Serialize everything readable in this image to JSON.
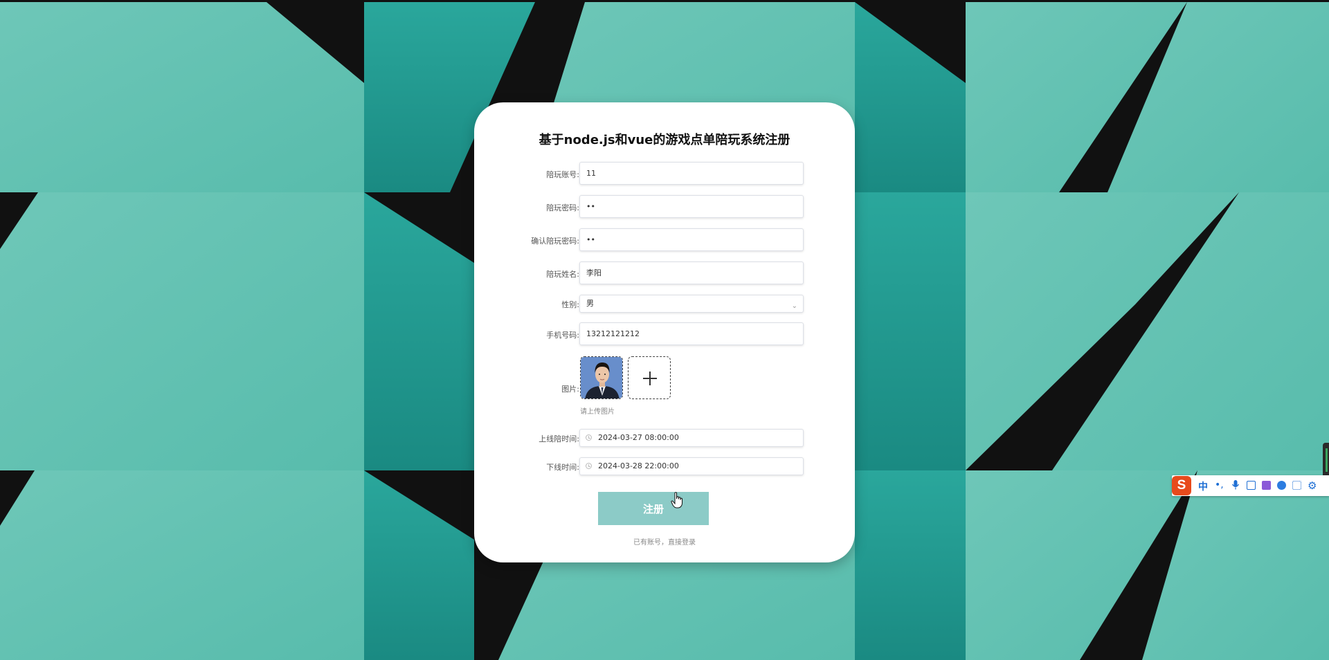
{
  "page": {
    "title": "基于node.js和vue的游戏点单陪玩系统注册"
  },
  "form": {
    "account": {
      "label": "陪玩账号:",
      "value": "11"
    },
    "password": {
      "label": "陪玩密码:",
      "value": "••"
    },
    "confirm_password": {
      "label": "确认陪玩密码:",
      "value": "••"
    },
    "name": {
      "label": "陪玩姓名:",
      "value": "李阳"
    },
    "gender": {
      "label": "性别:",
      "value": "男"
    },
    "phone": {
      "label": "手机号码:",
      "value": "13212121212"
    },
    "photo": {
      "label": "图片:",
      "hint": "请上传图片"
    },
    "online_time": {
      "label": "上线陪时间:",
      "value": "2024-03-27 08:00:00"
    },
    "offline_time": {
      "label": "下线时间:",
      "value": "2024-03-28 22:00:00"
    },
    "submit_label": "注册",
    "login_link": "已有账号，直接登录"
  },
  "ime_toolbar": {
    "logo": "S",
    "mode": "中",
    "punct": "•,"
  },
  "colors": {
    "teal_light": "#66c2b2",
    "teal_dark": "#1e8f88",
    "button": "#8ccbc7",
    "ime_logo": "#e84a1c"
  }
}
